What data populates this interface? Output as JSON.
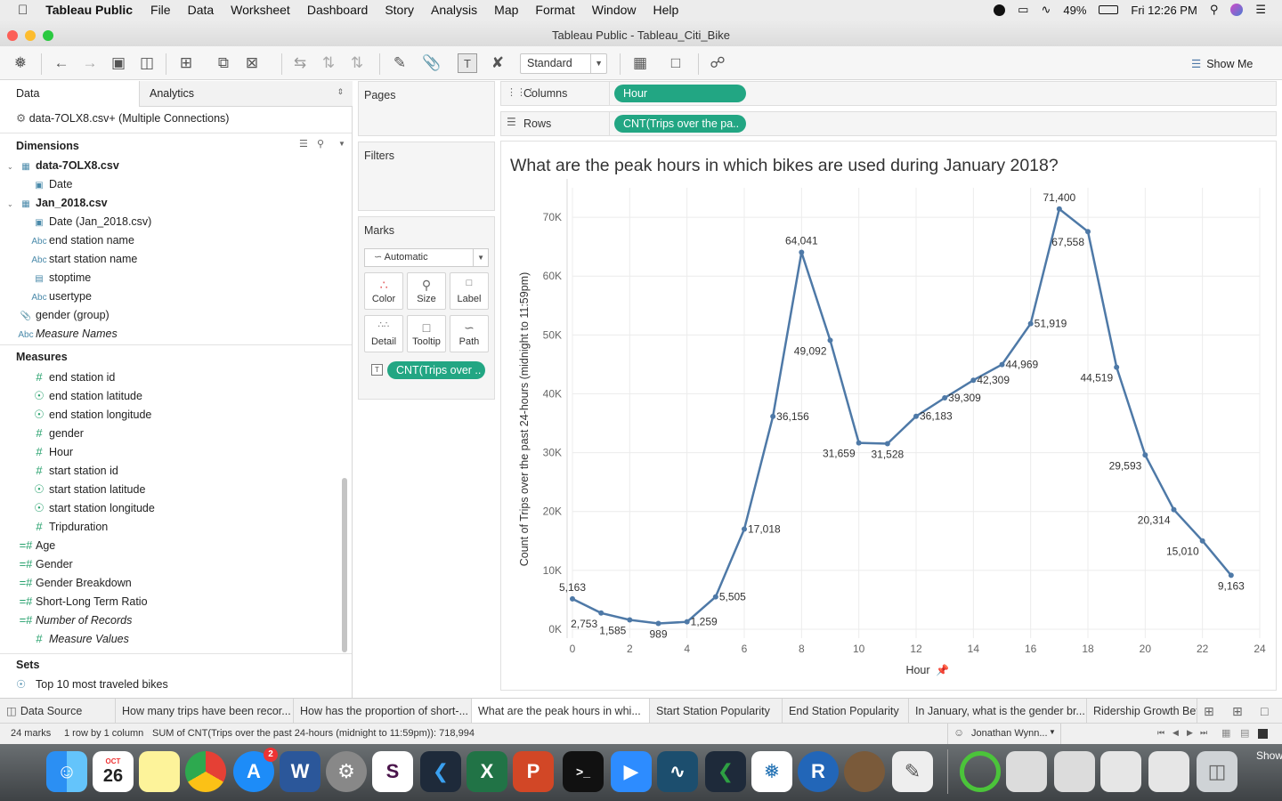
{
  "menubar": {
    "app": "Tableau Public",
    "items": [
      "File",
      "Data",
      "Worksheet",
      "Dashboard",
      "Story",
      "Analysis",
      "Map",
      "Format",
      "Window",
      "Help"
    ],
    "battery": "49%",
    "clock": "Fri 12:26 PM"
  },
  "window": {
    "title": "Tableau Public - Tableau_Citi_Bike"
  },
  "toolbar": {
    "mark_style": "Standard",
    "show_me": "Show Me"
  },
  "datapane": {
    "tab_data": "Data",
    "tab_analytics": "Analytics",
    "connection": "data-7OLX8.csv+ (Multiple Connections)",
    "dimensions_header": "Dimensions",
    "dimensions": [
      {
        "label": "data-7OLX8.csv",
        "icon": "table-icon",
        "bold": true
      },
      {
        "label": "Date",
        "icon": "calendar-icon"
      },
      {
        "label": "Jan_2018.csv",
        "icon": "table-icon",
        "bold": true
      },
      {
        "label": "Date (Jan_2018.csv)",
        "icon": "calendar-icon"
      },
      {
        "label": "end station name",
        "icon": "abc-icon"
      },
      {
        "label": "start station name",
        "icon": "abc-icon"
      },
      {
        "label": "stoptime",
        "icon": "datetime-icon"
      },
      {
        "label": "usertype",
        "icon": "abc-icon"
      },
      {
        "label": "gender (group)",
        "icon": "paperclip-icon"
      },
      {
        "label": "Measure Names",
        "icon": "abc-icon",
        "italic": true
      }
    ],
    "measures_header": "Measures",
    "measures": [
      {
        "label": "end station id",
        "icon": "hash-icon"
      },
      {
        "label": "end station latitude",
        "icon": "globe-icon"
      },
      {
        "label": "end station longitude",
        "icon": "globe-icon"
      },
      {
        "label": "gender",
        "icon": "hash-icon"
      },
      {
        "label": "Hour",
        "icon": "hash-icon"
      },
      {
        "label": "start station id",
        "icon": "hash-icon"
      },
      {
        "label": "start station latitude",
        "icon": "globe-icon"
      },
      {
        "label": "start station longitude",
        "icon": "globe-icon"
      },
      {
        "label": "Tripduration",
        "icon": "hash-icon"
      },
      {
        "label": "Age",
        "icon": "calc-hash-icon"
      },
      {
        "label": "Gender",
        "icon": "calc-hash-icon"
      },
      {
        "label": "Gender Breakdown",
        "icon": "calc-hash-icon"
      },
      {
        "label": "Short-Long Term Ratio",
        "icon": "calc-hash-icon"
      },
      {
        "label": "Number of Records",
        "icon": "calc-hash-icon",
        "italic": true
      },
      {
        "label": "Measure Values",
        "icon": "hash-icon",
        "italic": true
      }
    ],
    "sets_header": "Sets",
    "sets": [
      {
        "label": "Top 10 most traveled bikes",
        "icon": "set-icon"
      }
    ]
  },
  "cards": {
    "pages": "Pages",
    "filters": "Filters",
    "marks": "Marks",
    "mark_type": "Automatic",
    "mark_buttons": [
      "Color",
      "Size",
      "Label",
      "Detail",
      "Tooltip",
      "Path"
    ],
    "mark_pill": "CNT(Trips over .."
  },
  "shelves": {
    "columns_label": "Columns",
    "columns_pill": "Hour",
    "rows_label": "Rows",
    "rows_pill": "CNT(Trips over the pa.."
  },
  "chart_data": {
    "type": "line",
    "title": "What are the peak hours in which bikes are used during January 2018?",
    "xlabel": "Hour",
    "ylabel": "Count of Trips over the past 24-hours (midnight to 11:59pm)",
    "x": [
      0,
      1,
      2,
      3,
      4,
      5,
      6,
      7,
      8,
      9,
      10,
      11,
      12,
      13,
      14,
      15,
      16,
      17,
      18,
      19,
      20,
      21,
      22,
      23
    ],
    "values": [
      5163,
      2753,
      1585,
      989,
      1259,
      5505,
      17018,
      36156,
      64041,
      49092,
      31659,
      31528,
      36183,
      39309,
      42309,
      44969,
      51919,
      71400,
      67558,
      44519,
      29593,
      20314,
      15010,
      9163
    ],
    "value_labels": [
      "5,163",
      "2,753",
      "1,585",
      "989",
      "1,259",
      "5,505",
      "17,018",
      "36,156",
      "64,041",
      "49,092",
      "31,659",
      "31,528",
      "36,183",
      "39,309",
      "42,309",
      "44,969",
      "51,919",
      "71,400",
      "67,558",
      "44,519",
      "29,593",
      "20,314",
      "15,010",
      "9,163"
    ],
    "xlim": [
      0,
      24
    ],
    "ylim": [
      0,
      75000
    ],
    "x_ticks": [
      "0",
      "2",
      "4",
      "6",
      "8",
      "10",
      "12",
      "14",
      "16",
      "18",
      "20",
      "22",
      "24"
    ],
    "y_ticks": [
      "0K",
      "10K",
      "20K",
      "30K",
      "40K",
      "50K",
      "60K",
      "70K"
    ],
    "grid": true,
    "color": "#4e79a7"
  },
  "tabs": {
    "datasource": "Data Source",
    "sheets": [
      "How many trips have been recor...",
      "How has the proportion of short-...",
      "What are the peak hours in whi...",
      "Start Station Popularity",
      "End Station Popularity",
      "In January, what is the gender br...",
      "Ridership Growth Bet"
    ],
    "active_index": 2
  },
  "status": {
    "marks": "24 marks",
    "rows_cols": "1 row by 1 column",
    "sum": "SUM of CNT(Trips over the past 24-hours (midnight to 11:59pm)): 718,994",
    "user": "Jonathan Wynn..."
  },
  "dock": {
    "calendar_month": "OCT",
    "calendar_day": "26",
    "appstore_badge": "2",
    "show_label": "Show"
  },
  "colors": {
    "accent": "#22a683",
    "line": "#4e79a7"
  }
}
